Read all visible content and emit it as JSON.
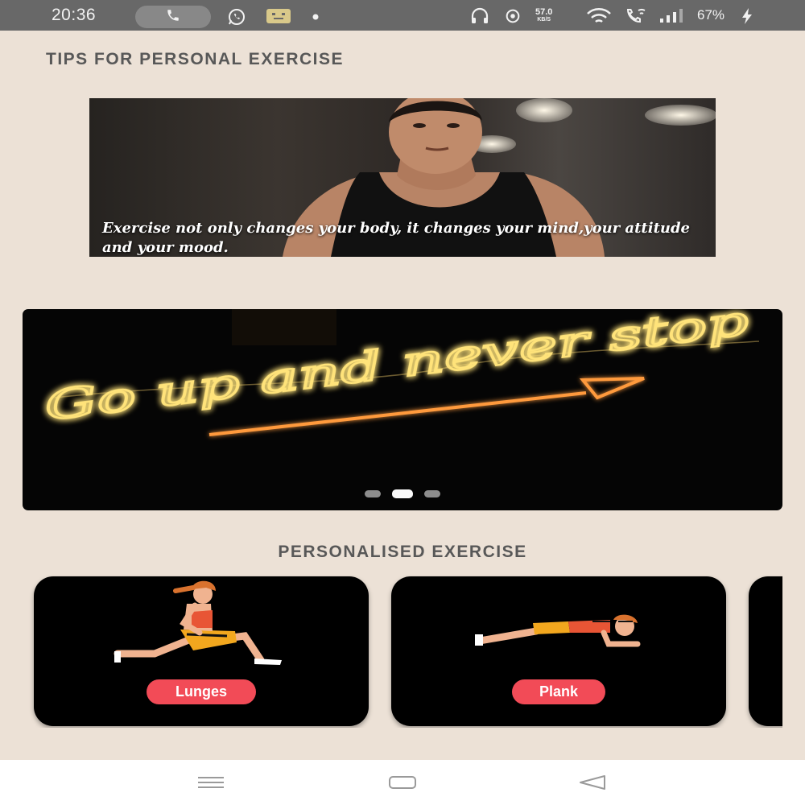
{
  "status_bar": {
    "time": "20:36",
    "network_speed": "57.0",
    "network_speed_unit": "KB/S",
    "battery": "67%",
    "icons": [
      "phone-icon",
      "whatsapp-icon",
      "notification-app-icon",
      "dot-icon",
      "headset-icon",
      "location-icon",
      "wifi-icon",
      "wifi-calling-icon",
      "signal-icon",
      "charging-icon"
    ]
  },
  "tips": {
    "title": "TIPS FOR PERSONAL EXERCISE",
    "quote": "Exercise not only changes your body, it changes your mind,your attitude and your mood."
  },
  "carousel": {
    "slide_text": "Go up and never stop",
    "active_index": 1,
    "dot_count": 3
  },
  "personalised": {
    "title": "PERSONALISED EXERCISE",
    "exercises": [
      {
        "label": "Lunges"
      },
      {
        "label": "Plank"
      }
    ]
  },
  "nav": {
    "icons": [
      "menu-icon",
      "home-icon",
      "back-icon"
    ]
  },
  "colors": {
    "background": "#ece1d6",
    "badge": "#f24b57",
    "status_bar": "#686868",
    "neon": "#ffd84a"
  }
}
